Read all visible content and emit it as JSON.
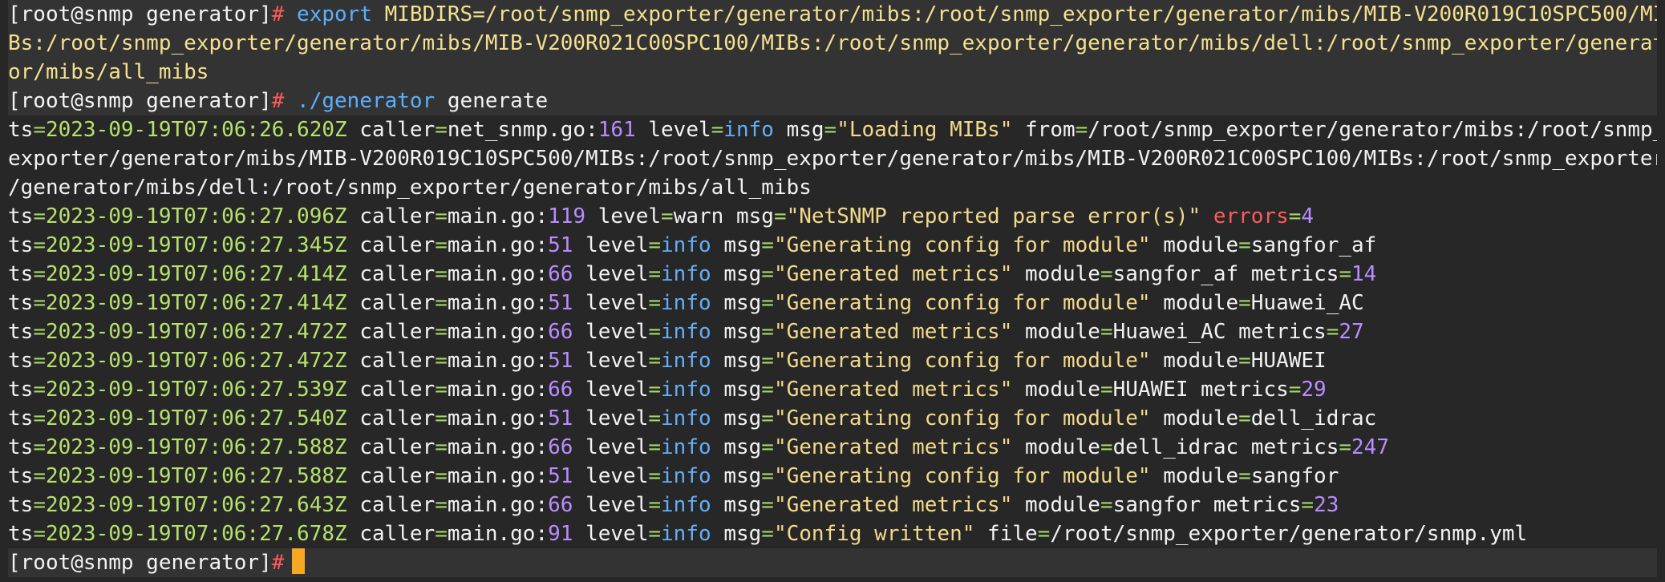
{
  "terminal": {
    "prompt": "[root@snmp generator]",
    "prompt_symbol": "#",
    "commands": {
      "export_cmd": "export",
      "export_arg_1": "MIBDIRS=/root/snmp_exporter/generator/mibs:/root/snmp_exporter/generator/mibs/MIB-V200R019C10SPC500/MI",
      "export_arg_2": "Bs:/root/snmp_exporter/generator/mibs/MIB-V200R021C00SPC100/MIBs:/root/snmp_exporter/generator/mibs/dell:/root/snmp_exporter/generat",
      "export_arg_3": "or/mibs/all_mibs",
      "gen_cmd": "./generator",
      "gen_arg": "generate"
    },
    "loading": {
      "ts": "2023-09-19T07:06:26.620Z",
      "caller_file": "net_snmp.go",
      "caller_line": "161",
      "level": "info",
      "msg": "\"Loading MIBs\"",
      "from_1": "/root/snmp_exporter/generator/mibs:/root/snmp_",
      "from_2": "exporter/generator/mibs/MIB-V200R019C10SPC500/MIBs:/root/snmp_exporter/generator/mibs/MIB-V200R021C00SPC100/MIBs:/root/snmp_exporter",
      "from_3": "/generator/mibs/dell:/root/snmp_exporter/generator/mibs/all_mibs"
    },
    "warn": {
      "ts": "2023-09-19T07:06:27.096Z",
      "caller_file": "main.go",
      "caller_line": "119",
      "level": "warn",
      "msg": "\"NetSNMP reported parse error(s)\"",
      "errors_key": "errors",
      "errors_val": "4"
    },
    "logs": [
      {
        "ts": "2023-09-19T07:06:27.345Z",
        "line": "51",
        "level": "info",
        "msg": "\"Generating config for module\"",
        "module": "sangfor_af",
        "metrics": ""
      },
      {
        "ts": "2023-09-19T07:06:27.414Z",
        "line": "66",
        "level": "info",
        "msg": "\"Generated metrics\"",
        "module": "sangfor_af",
        "metrics": "14"
      },
      {
        "ts": "2023-09-19T07:06:27.414Z",
        "line": "51",
        "level": "info",
        "msg": "\"Generating config for module\"",
        "module": "Huawei_AC",
        "metrics": ""
      },
      {
        "ts": "2023-09-19T07:06:27.472Z",
        "line": "66",
        "level": "info",
        "msg": "\"Generated metrics\"",
        "module": "Huawei_AC",
        "metrics": "27"
      },
      {
        "ts": "2023-09-19T07:06:27.472Z",
        "line": "51",
        "level": "info",
        "msg": "\"Generating config for module\"",
        "module": "HUAWEI",
        "metrics": ""
      },
      {
        "ts": "2023-09-19T07:06:27.539Z",
        "line": "66",
        "level": "info",
        "msg": "\"Generated metrics\"",
        "module": "HUAWEI",
        "metrics": "29"
      },
      {
        "ts": "2023-09-19T07:06:27.540Z",
        "line": "51",
        "level": "info",
        "msg": "\"Generating config for module\"",
        "module": "dell_idrac",
        "metrics": ""
      },
      {
        "ts": "2023-09-19T07:06:27.588Z",
        "line": "66",
        "level": "info",
        "msg": "\"Generated metrics\"",
        "module": "dell_idrac",
        "metrics": "247"
      },
      {
        "ts": "2023-09-19T07:06:27.588Z",
        "line": "51",
        "level": "info",
        "msg": "\"Generating config for module\"",
        "module": "sangfor",
        "metrics": ""
      },
      {
        "ts": "2023-09-19T07:06:27.643Z",
        "line": "66",
        "level": "info",
        "msg": "\"Generated metrics\"",
        "module": "sangfor",
        "metrics": "23"
      }
    ],
    "written": {
      "ts": "2023-09-19T07:06:27.678Z",
      "caller_file": "main.go",
      "caller_line": "91",
      "level": "info",
      "msg": "\"Config written\"",
      "file": "/root/snmp_exporter/generator/snmp.yml"
    },
    "labels": {
      "ts": "ts",
      "caller": "caller",
      "level": "level",
      "msg": "msg",
      "from": "from",
      "module": "module",
      "metrics": "metrics",
      "file": "file",
      "main_go": "main.go"
    },
    "colors": {
      "background": "#272727",
      "command_row": "#333333",
      "cursor": "#f7a823"
    }
  }
}
